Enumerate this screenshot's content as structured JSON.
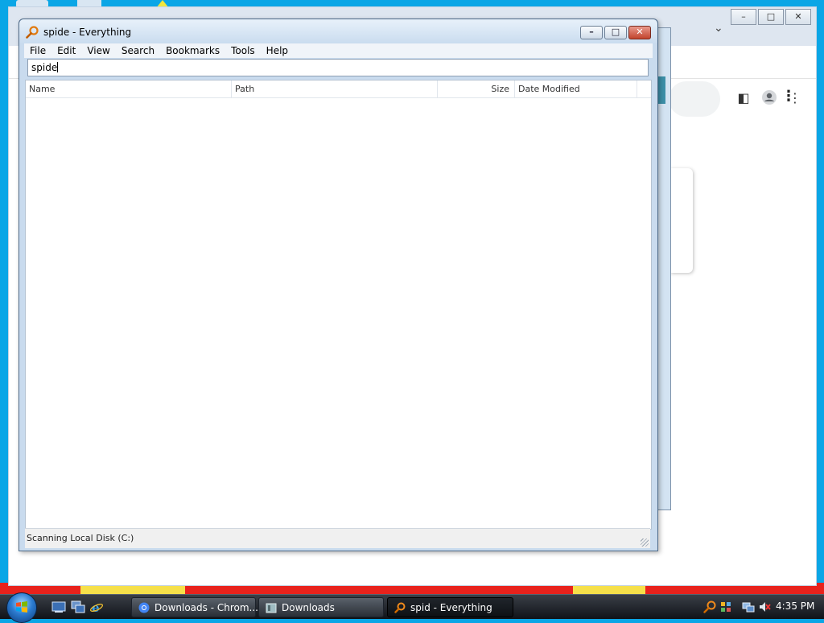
{
  "everything": {
    "title": "spide - Everything",
    "menu": [
      "File",
      "Edit",
      "View",
      "Search",
      "Bookmarks",
      "Tools",
      "Help"
    ],
    "search_value": "spide",
    "columns": {
      "name": "Name",
      "path": "Path",
      "size": "Size",
      "date_modified": "Date Modified"
    },
    "status": "Scanning Local Disk (C:)"
  },
  "taskbar": {
    "buttons": [
      {
        "label": "Downloads - Chrom...",
        "icon": "chrome-icon"
      },
      {
        "label": "Downloads",
        "icon": "folder-icon"
      },
      {
        "label": "spid - Everything",
        "icon": "everything-search-icon"
      }
    ],
    "clock": "4:35 PM"
  },
  "colors": {
    "desktop": "#0aa6e6",
    "everything_frame": "#c9dbee",
    "close_button": "#c2432c"
  }
}
